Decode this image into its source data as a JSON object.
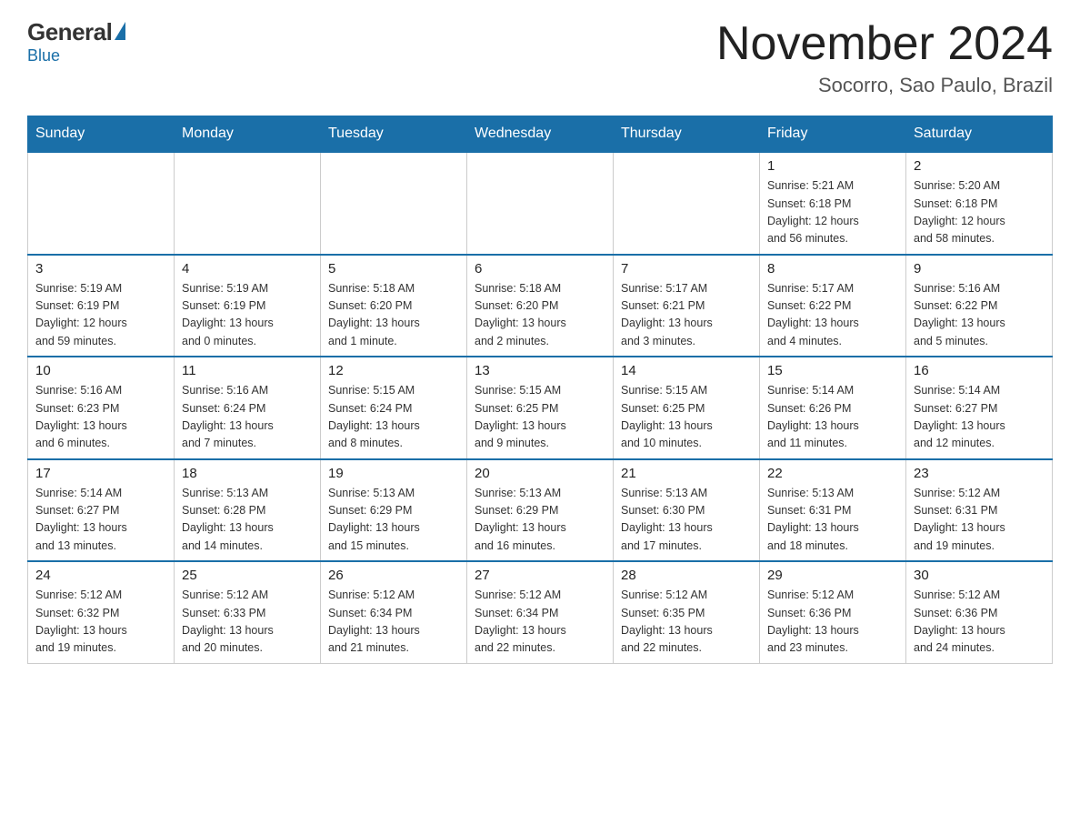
{
  "header": {
    "logo": {
      "general": "General",
      "blue": "Blue"
    },
    "title": "November 2024",
    "location": "Socorro, Sao Paulo, Brazil"
  },
  "weekdays": [
    "Sunday",
    "Monday",
    "Tuesday",
    "Wednesday",
    "Thursday",
    "Friday",
    "Saturday"
  ],
  "weeks": [
    [
      {
        "day": "",
        "info": "",
        "empty": true
      },
      {
        "day": "",
        "info": "",
        "empty": true
      },
      {
        "day": "",
        "info": "",
        "empty": true
      },
      {
        "day": "",
        "info": "",
        "empty": true
      },
      {
        "day": "",
        "info": "",
        "empty": true
      },
      {
        "day": "1",
        "info": "Sunrise: 5:21 AM\nSunset: 6:18 PM\nDaylight: 12 hours\nand 56 minutes."
      },
      {
        "day": "2",
        "info": "Sunrise: 5:20 AM\nSunset: 6:18 PM\nDaylight: 12 hours\nand 58 minutes."
      }
    ],
    [
      {
        "day": "3",
        "info": "Sunrise: 5:19 AM\nSunset: 6:19 PM\nDaylight: 12 hours\nand 59 minutes."
      },
      {
        "day": "4",
        "info": "Sunrise: 5:19 AM\nSunset: 6:19 PM\nDaylight: 13 hours\nand 0 minutes."
      },
      {
        "day": "5",
        "info": "Sunrise: 5:18 AM\nSunset: 6:20 PM\nDaylight: 13 hours\nand 1 minute."
      },
      {
        "day": "6",
        "info": "Sunrise: 5:18 AM\nSunset: 6:20 PM\nDaylight: 13 hours\nand 2 minutes."
      },
      {
        "day": "7",
        "info": "Sunrise: 5:17 AM\nSunset: 6:21 PM\nDaylight: 13 hours\nand 3 minutes."
      },
      {
        "day": "8",
        "info": "Sunrise: 5:17 AM\nSunset: 6:22 PM\nDaylight: 13 hours\nand 4 minutes."
      },
      {
        "day": "9",
        "info": "Sunrise: 5:16 AM\nSunset: 6:22 PM\nDaylight: 13 hours\nand 5 minutes."
      }
    ],
    [
      {
        "day": "10",
        "info": "Sunrise: 5:16 AM\nSunset: 6:23 PM\nDaylight: 13 hours\nand 6 minutes."
      },
      {
        "day": "11",
        "info": "Sunrise: 5:16 AM\nSunset: 6:24 PM\nDaylight: 13 hours\nand 7 minutes."
      },
      {
        "day": "12",
        "info": "Sunrise: 5:15 AM\nSunset: 6:24 PM\nDaylight: 13 hours\nand 8 minutes."
      },
      {
        "day": "13",
        "info": "Sunrise: 5:15 AM\nSunset: 6:25 PM\nDaylight: 13 hours\nand 9 minutes."
      },
      {
        "day": "14",
        "info": "Sunrise: 5:15 AM\nSunset: 6:25 PM\nDaylight: 13 hours\nand 10 minutes."
      },
      {
        "day": "15",
        "info": "Sunrise: 5:14 AM\nSunset: 6:26 PM\nDaylight: 13 hours\nand 11 minutes."
      },
      {
        "day": "16",
        "info": "Sunrise: 5:14 AM\nSunset: 6:27 PM\nDaylight: 13 hours\nand 12 minutes."
      }
    ],
    [
      {
        "day": "17",
        "info": "Sunrise: 5:14 AM\nSunset: 6:27 PM\nDaylight: 13 hours\nand 13 minutes."
      },
      {
        "day": "18",
        "info": "Sunrise: 5:13 AM\nSunset: 6:28 PM\nDaylight: 13 hours\nand 14 minutes."
      },
      {
        "day": "19",
        "info": "Sunrise: 5:13 AM\nSunset: 6:29 PM\nDaylight: 13 hours\nand 15 minutes."
      },
      {
        "day": "20",
        "info": "Sunrise: 5:13 AM\nSunset: 6:29 PM\nDaylight: 13 hours\nand 16 minutes."
      },
      {
        "day": "21",
        "info": "Sunrise: 5:13 AM\nSunset: 6:30 PM\nDaylight: 13 hours\nand 17 minutes."
      },
      {
        "day": "22",
        "info": "Sunrise: 5:13 AM\nSunset: 6:31 PM\nDaylight: 13 hours\nand 18 minutes."
      },
      {
        "day": "23",
        "info": "Sunrise: 5:12 AM\nSunset: 6:31 PM\nDaylight: 13 hours\nand 19 minutes."
      }
    ],
    [
      {
        "day": "24",
        "info": "Sunrise: 5:12 AM\nSunset: 6:32 PM\nDaylight: 13 hours\nand 19 minutes."
      },
      {
        "day": "25",
        "info": "Sunrise: 5:12 AM\nSunset: 6:33 PM\nDaylight: 13 hours\nand 20 minutes."
      },
      {
        "day": "26",
        "info": "Sunrise: 5:12 AM\nSunset: 6:34 PM\nDaylight: 13 hours\nand 21 minutes."
      },
      {
        "day": "27",
        "info": "Sunrise: 5:12 AM\nSunset: 6:34 PM\nDaylight: 13 hours\nand 22 minutes."
      },
      {
        "day": "28",
        "info": "Sunrise: 5:12 AM\nSunset: 6:35 PM\nDaylight: 13 hours\nand 22 minutes."
      },
      {
        "day": "29",
        "info": "Sunrise: 5:12 AM\nSunset: 6:36 PM\nDaylight: 13 hours\nand 23 minutes."
      },
      {
        "day": "30",
        "info": "Sunrise: 5:12 AM\nSunset: 6:36 PM\nDaylight: 13 hours\nand 24 minutes."
      }
    ]
  ]
}
